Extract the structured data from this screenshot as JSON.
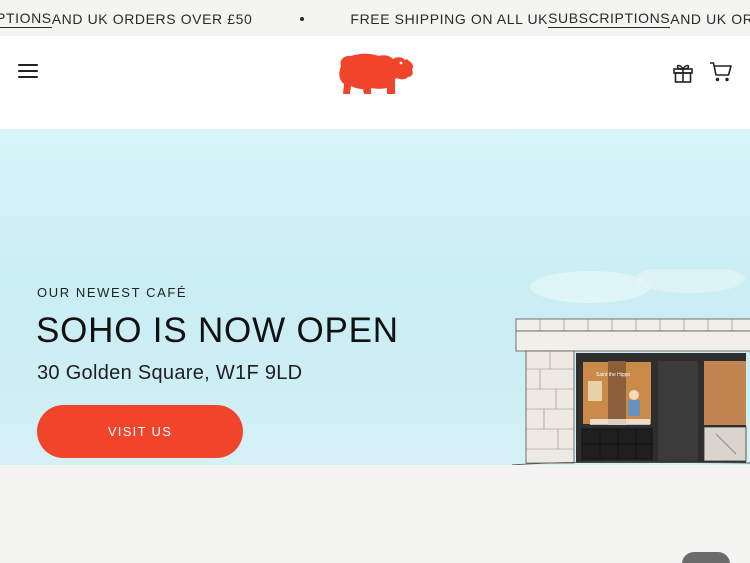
{
  "announcement": {
    "part1_link": "PTIONS",
    "part1_text": " AND UK ORDERS OVER £50",
    "part2_text": "FREE SHIPPING ON ALL UK ",
    "part2_link": "SUBSCRIPTIONS",
    "part2_tail": " AND UK ORDERS"
  },
  "header": {
    "menu_icon": "hamburger-icon",
    "logo_icon": "hippo-logo",
    "gift_icon": "gift-icon",
    "cart_icon": "cart-icon"
  },
  "hero": {
    "eyebrow": "OUR NEWEST CAFÉ",
    "headline": "SOHO IS NOW OPEN",
    "address": "30 Golden Square, W1F 9LD",
    "cta_label": "VISIT US",
    "storefront_sign": "Saint the Hippo"
  },
  "colors": {
    "brand": "#f0452b",
    "hero_bg": "#cdeef4",
    "announce_bg": "#f4f4f2"
  }
}
